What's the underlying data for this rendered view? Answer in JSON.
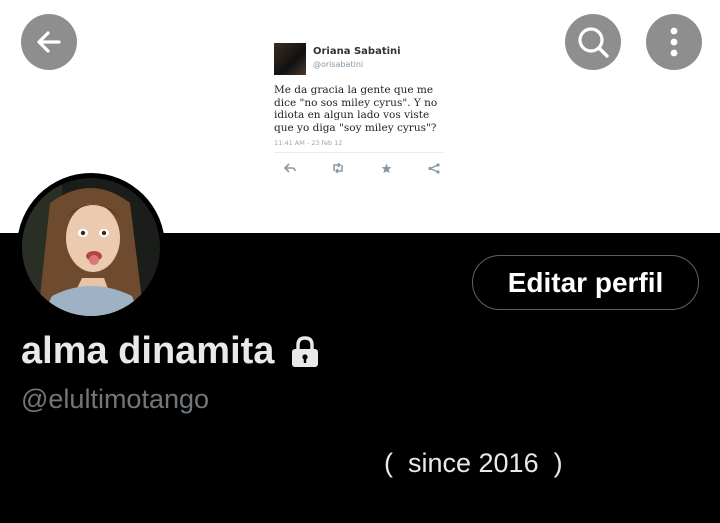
{
  "header": {
    "back_icon": "arrow-left-icon",
    "search_icon": "search-icon",
    "more_icon": "more-vertical-icon"
  },
  "banner_tweet": {
    "name": "Oriana Sabatini",
    "handle": "@orisabatini",
    "text": "Me da gracia la gente que me dice \"no sos miley cyrus\". Y no idiota en algun lado vos viste que yo diga \"soy miley cyrus\"?",
    "time": "11:41 AM - 23 feb 12",
    "actions": [
      "reply-icon",
      "retweet-icon",
      "favorite-icon",
      "share-icon"
    ]
  },
  "profile": {
    "edit_label": "Editar perfil",
    "display_name": "alma dinamita",
    "lock_icon": "lock-icon",
    "handle": "@elultimotango",
    "bio": "(  since 2016  )"
  },
  "colors": {
    "background": "#000000",
    "banner": "#ffffff",
    "name_text": "#e7e9ea",
    "handle_text": "#71767b",
    "button_border": "#536471"
  }
}
